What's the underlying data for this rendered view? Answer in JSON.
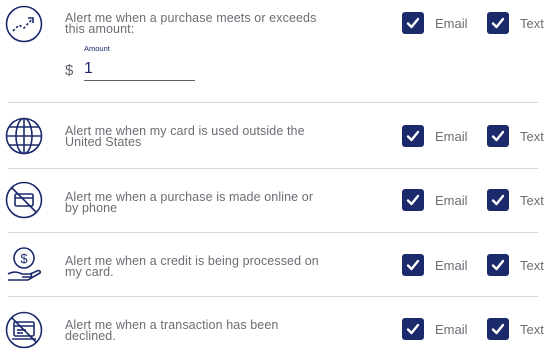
{
  "alerts": [
    {
      "label": "Alert me when a purchase meets or exceeds this amount:",
      "icon": "trending-up-icon",
      "email_label": "Email",
      "text_label": "Text",
      "email_checked": true,
      "text_checked": true,
      "amount_caption": "Amount",
      "currency_symbol": "$",
      "amount_value": "1"
    },
    {
      "label": "Alert me when my card is used outside the United States",
      "icon": "globe-icon",
      "email_label": "Email",
      "text_label": "Text",
      "email_checked": true,
      "text_checked": true
    },
    {
      "label": "Alert me when a purchase is made online or by phone",
      "icon": "no-card-icon",
      "email_label": "Email",
      "text_label": "Text",
      "email_checked": true,
      "text_checked": true
    },
    {
      "label": "Alert me when a credit is being processed on my card.",
      "icon": "dollar-hand-icon",
      "email_label": "Email",
      "text_label": "Text",
      "email_checked": true,
      "text_checked": true
    },
    {
      "label": "Alert me when a transaction has been declined.",
      "icon": "declined-card-icon",
      "email_label": "Email",
      "text_label": "Text",
      "email_checked": true,
      "text_checked": true
    }
  ],
  "colors": {
    "checkbox": "#1b2a6b",
    "icon": "#1b2a6b",
    "text": "#6a6e74",
    "divider": "#d5d7da"
  }
}
